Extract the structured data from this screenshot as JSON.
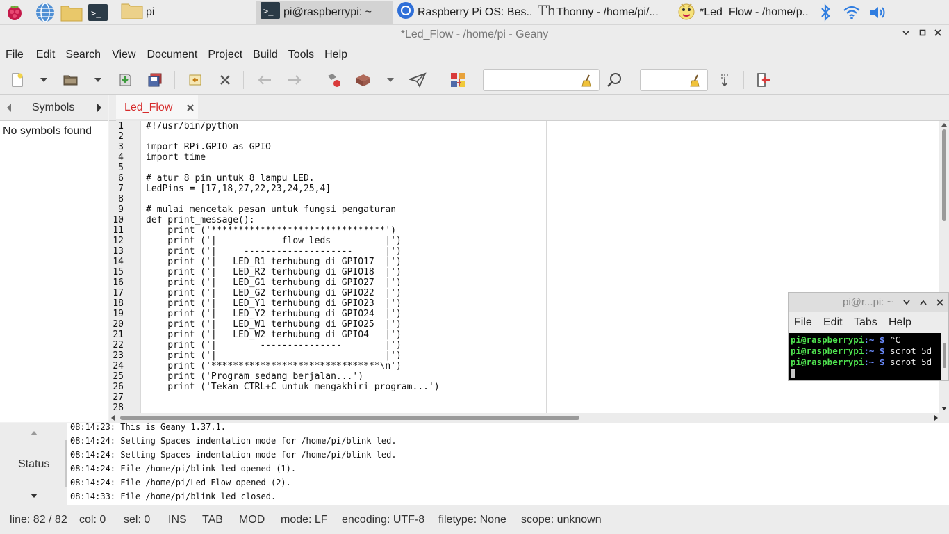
{
  "taskbar": {
    "folder_label": "pi",
    "tasks": [
      {
        "label": "pi@raspberrypi: ~"
      },
      {
        "label": "Raspberry Pi OS: Bes..."
      },
      {
        "label": "Thonny  -  /home/pi/..."
      },
      {
        "label": "*Led_Flow - /home/p..."
      }
    ]
  },
  "window": {
    "title": "*Led_Flow - /home/pi - Geany"
  },
  "menu": [
    "File",
    "Edit",
    "Search",
    "View",
    "Document",
    "Project",
    "Build",
    "Tools",
    "Help"
  ],
  "sidebar": {
    "tab_label": "Symbols",
    "empty_text": "No symbols found"
  },
  "document_tab": {
    "label": "Led_Flow",
    "color": "#d62b2b"
  },
  "editor": {
    "line_numbers": [
      "1",
      "2",
      "3",
      "4",
      "5",
      "6",
      "7",
      "8",
      "9",
      "10",
      "11",
      "12",
      "13",
      "14",
      "15",
      "16",
      "17",
      "18",
      "19",
      "20",
      "21",
      "22",
      "23",
      "24",
      "25",
      "26",
      "27",
      "28"
    ],
    "lines": [
      "#!/usr/bin/python",
      "",
      "import RPi.GPIO as GPIO",
      "import time",
      "",
      "# atur 8 pin untuk 8 lampu LED.",
      "LedPins = [17,18,27,22,23,24,25,4]",
      "",
      "# mulai mencetak pesan untuk fungsi pengaturan",
      "def print_message():",
      "    print ('********************************')",
      "    print ('|            flow leds          |')",
      "    print ('|     --------------------      |')",
      "    print ('|   LED_R1 terhubung di GPIO17  |')",
      "    print ('|   LED_R2 terhubung di GPIO18  |')",
      "    print ('|   LED_G1 terhubung di GPIO27  |')",
      "    print ('|   LED_G2 terhubung di GPIO22  |')",
      "    print ('|   LED_Y1 terhubung di GPIO23  |')",
      "    print ('|   LED_Y2 terhubung di GPIO24  |')",
      "    print ('|   LED_W1 terhubung di GPIO25  |')",
      "    print ('|   LED_W2 terhubung di GPIO4   |')",
      "    print ('|        ---------------        |')",
      "    print ('|                               |')",
      "    print ('*******************************\\n')",
      "    print ('Program sedang berjalan...')",
      "    print ('Tekan CTRL+C untuk mengakhiri program...')",
      "",
      ""
    ]
  },
  "messages": {
    "side_label": "Status",
    "lines": [
      "08:14:23: This is Geany 1.37.1.",
      "08:14:24: Setting Spaces indentation mode for /home/pi/blink led.",
      "08:14:24: Setting Spaces indentation mode for /home/pi/blink led.",
      "08:14:24: File /home/pi/blink led opened (1).",
      "08:14:24: File /home/pi/Led_Flow opened (2).",
      "08:14:33: File /home/pi/blink led closed."
    ]
  },
  "statusbar": {
    "line": "line: 82 / 82",
    "col": "col: 0",
    "sel": "sel: 0",
    "ins": "INS",
    "tab": "TAB",
    "mod": "MOD",
    "mode": "mode: LF",
    "encoding": "encoding: UTF-8",
    "filetype": "filetype: None",
    "scope": "scope: unknown"
  },
  "terminal": {
    "title": "pi@r...pi: ~",
    "menu": [
      "File",
      "Edit",
      "Tabs",
      "Help"
    ],
    "prompt_user": "pi@raspberrypi",
    "prompt_rest": ":~ $",
    "commands": [
      "^C",
      "scrot 5d",
      "scrot 5d"
    ],
    "colors": {
      "user": "#4fe34f",
      "path": "#6b8cff",
      "text": "#e8e8e8"
    }
  }
}
